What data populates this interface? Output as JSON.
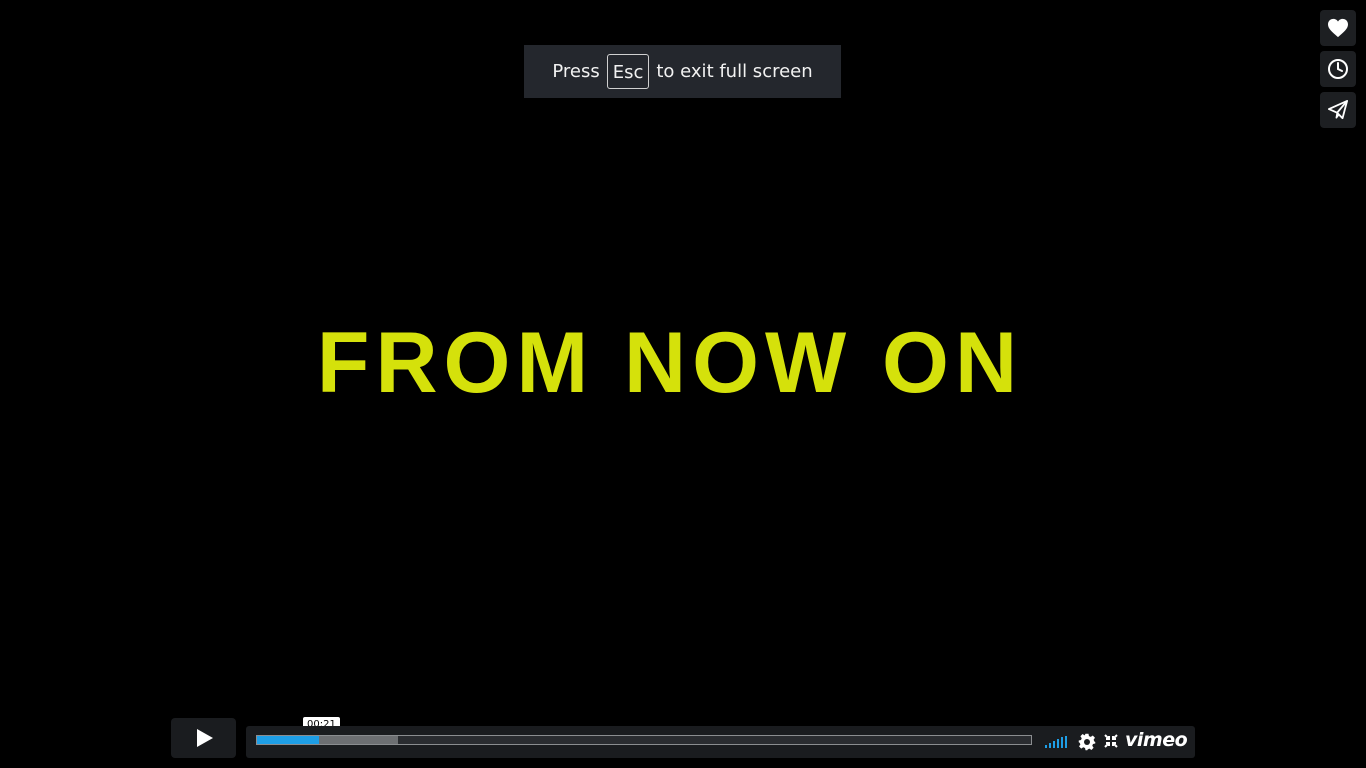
{
  "fullscreen_notice": {
    "before": "Press",
    "key": "Esc",
    "after": "to exit full screen"
  },
  "video": {
    "overlay_text": "FROM NOW ON",
    "text_color": "#d5e10b"
  },
  "side_actions": [
    {
      "icon": "heart-icon"
    },
    {
      "icon": "clock-icon"
    },
    {
      "icon": "send-icon"
    }
  ],
  "controls": {
    "time_tooltip": "00:21",
    "played_fraction": 0.08,
    "loaded_fraction": 0.182,
    "accent_color": "#1e9ee6",
    "logo_text": "vimeo"
  }
}
